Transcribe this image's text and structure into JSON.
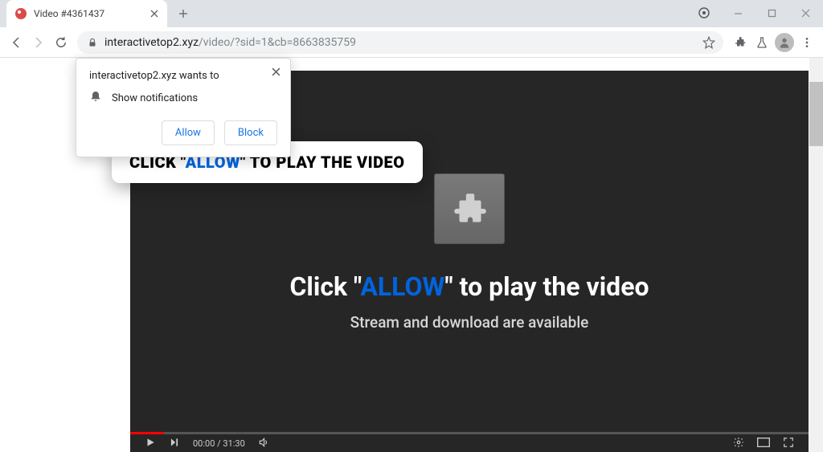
{
  "tab": {
    "title": "Video #4361437"
  },
  "url": {
    "domain": "interactivetop2.xyz",
    "path": "/video/?sid=1&cb=8663835759"
  },
  "permission": {
    "title_prefix": "interactivetop2.xyz",
    "title_suffix": " wants to",
    "item": "Show notifications",
    "allow": "Allow",
    "block": "Block"
  },
  "overlay": {
    "pre": "CLICK \"",
    "allow": "ALLOW",
    "post": "\" TO PLAY THE VIDEO"
  },
  "main": {
    "pre": "Click \"",
    "allow": "ALLOW",
    "post": "\" to play the video",
    "sub": "Stream and download are available"
  },
  "controls": {
    "time": "00:00 / 31:30"
  }
}
